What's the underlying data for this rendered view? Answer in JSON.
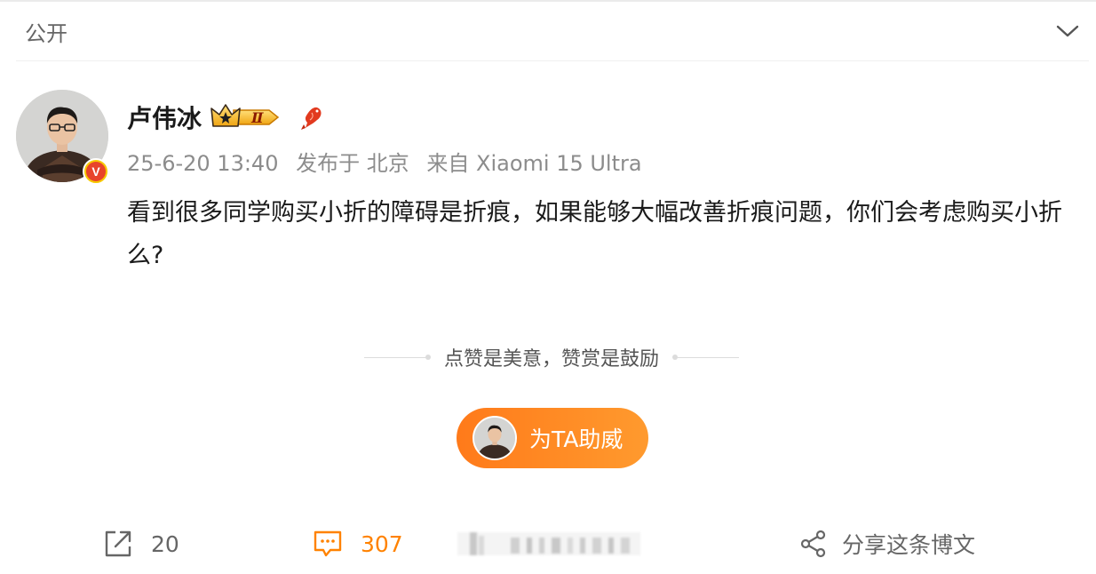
{
  "visibility": {
    "label": "公开",
    "toggle_icon": "chevron-down-icon"
  },
  "post": {
    "author": {
      "name": "卢伟冰",
      "verified_badge": "V",
      "vip_level": "Ⅱ",
      "vip_icon": "crown-icon",
      "decoration_icon": "koi-fish-icon"
    },
    "meta": {
      "time": "25-6-20 13:40",
      "location": "发布于 北京",
      "source": "来自 Xiaomi 15 Ultra"
    },
    "content": "看到很多同学购买小折的障碍是折痕，如果能够大幅改善折痕问题，你们会考虑购买小折么?"
  },
  "reward": {
    "tip": "点赞是美意，赞赏是鼓励",
    "button_label": "为TA助威"
  },
  "actions": {
    "repost_count": "20",
    "comment_count": "307",
    "share_label": "分享这条博文"
  },
  "colors": {
    "accent": "#ff8200",
    "badge_red": "#e8442b",
    "badge_gold": "#f7c800",
    "text_muted": "#8c8c8c"
  }
}
